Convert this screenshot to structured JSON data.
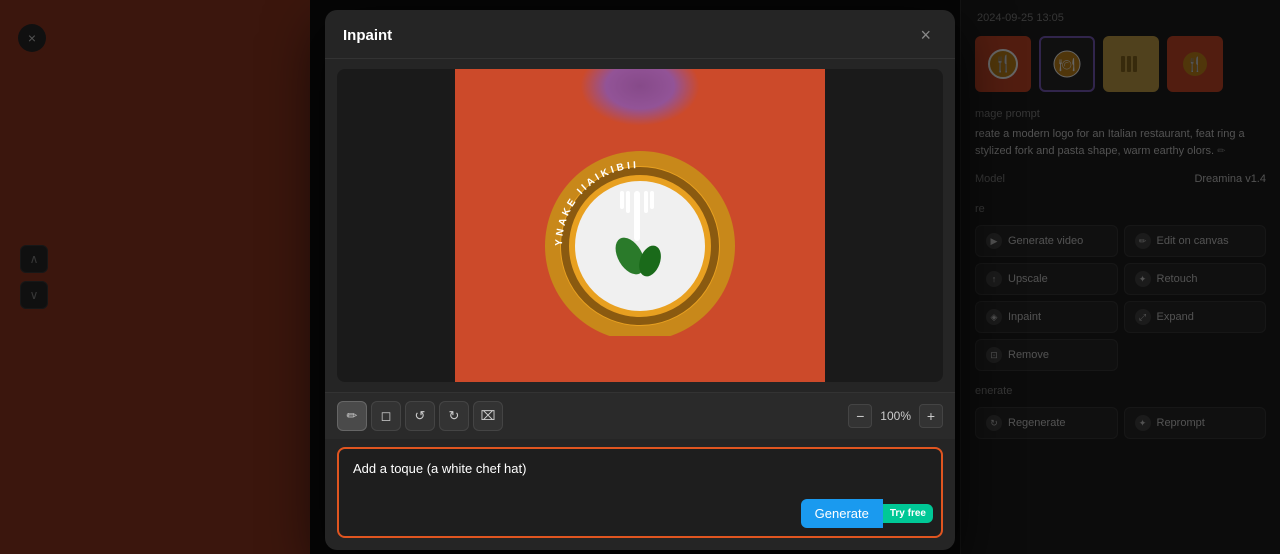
{
  "app": {
    "title": "Inpaint"
  },
  "background": {
    "close_label": "×"
  },
  "right_panel": {
    "timestamp": "2024-09-25 13:05",
    "image_prompt_label": "mage prompt",
    "image_prompt_text": "reate a modern logo for an Italian restaurant, feat ring a stylized fork and pasta shape, warm earthy olors.",
    "model_label": "Model",
    "model_value": "Dreamina v1.4",
    "more_label": "re",
    "actions": [
      {
        "id": "generate-video",
        "label": "Generate video",
        "icon": "▶"
      },
      {
        "id": "edit-on-canvas",
        "label": "Edit on canvas",
        "icon": "✏"
      },
      {
        "id": "upscale",
        "label": "Upscale",
        "icon": "↑"
      },
      {
        "id": "retouch",
        "label": "Retouch",
        "icon": "✦"
      },
      {
        "id": "inpaint",
        "label": "Inpaint",
        "icon": "◈"
      },
      {
        "id": "expand",
        "label": "Expand",
        "icon": "⤢"
      },
      {
        "id": "remove",
        "label": "Remove",
        "icon": "⊡"
      }
    ],
    "generate_label": "enerate",
    "generate_actions": [
      {
        "id": "regenerate",
        "label": "Regenerate",
        "icon": "↻"
      },
      {
        "id": "reprompt",
        "label": "Reprompt",
        "icon": "✦"
      }
    ]
  },
  "modal": {
    "title": "Inpaint",
    "close_label": "×",
    "zoom_value": "100%",
    "prompt_placeholder": "Add a toque (a white chef hat)",
    "prompt_value": "Add a toque (a white chef hat)",
    "generate_btn_label": "Generate",
    "try_free_label": "Try free"
  },
  "toolbar": {
    "brush_icon": "✏",
    "eraser_icon": "◻",
    "undo_icon": "↺",
    "redo_icon": "↻",
    "lasso_icon": "⌧",
    "zoom_minus": "−",
    "zoom_plus": "+"
  },
  "scroll": {
    "up_icon": "∧",
    "down_icon": "∨"
  }
}
